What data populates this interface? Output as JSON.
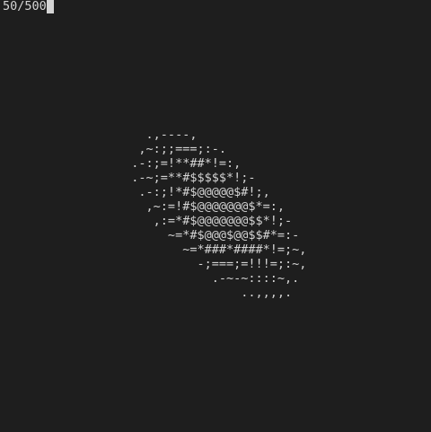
{
  "terminal": {
    "progress_text": "50/500",
    "art_lines": [
      "                    .,----,",
      "                   ,~:;;===;:-.",
      "                  .-:;=!**##*!=:,",
      "                  .-~;=**#$$$$$*!;-",
      "                   .-:;!*#$@@@@@$#!;,",
      "                    ,~:=!#$@@@@@@@$*=:,",
      "                     ,:=*#$@@@@@@@$$*!;-",
      "                       ~=*#$@@@$@@$$#*=:-",
      "                         ~=*###*####*!=;~,",
      "                           -;===;=!!!=;:~,",
      "                             .-~-~::::~,.",
      "                                 ..,,,,."
    ]
  }
}
